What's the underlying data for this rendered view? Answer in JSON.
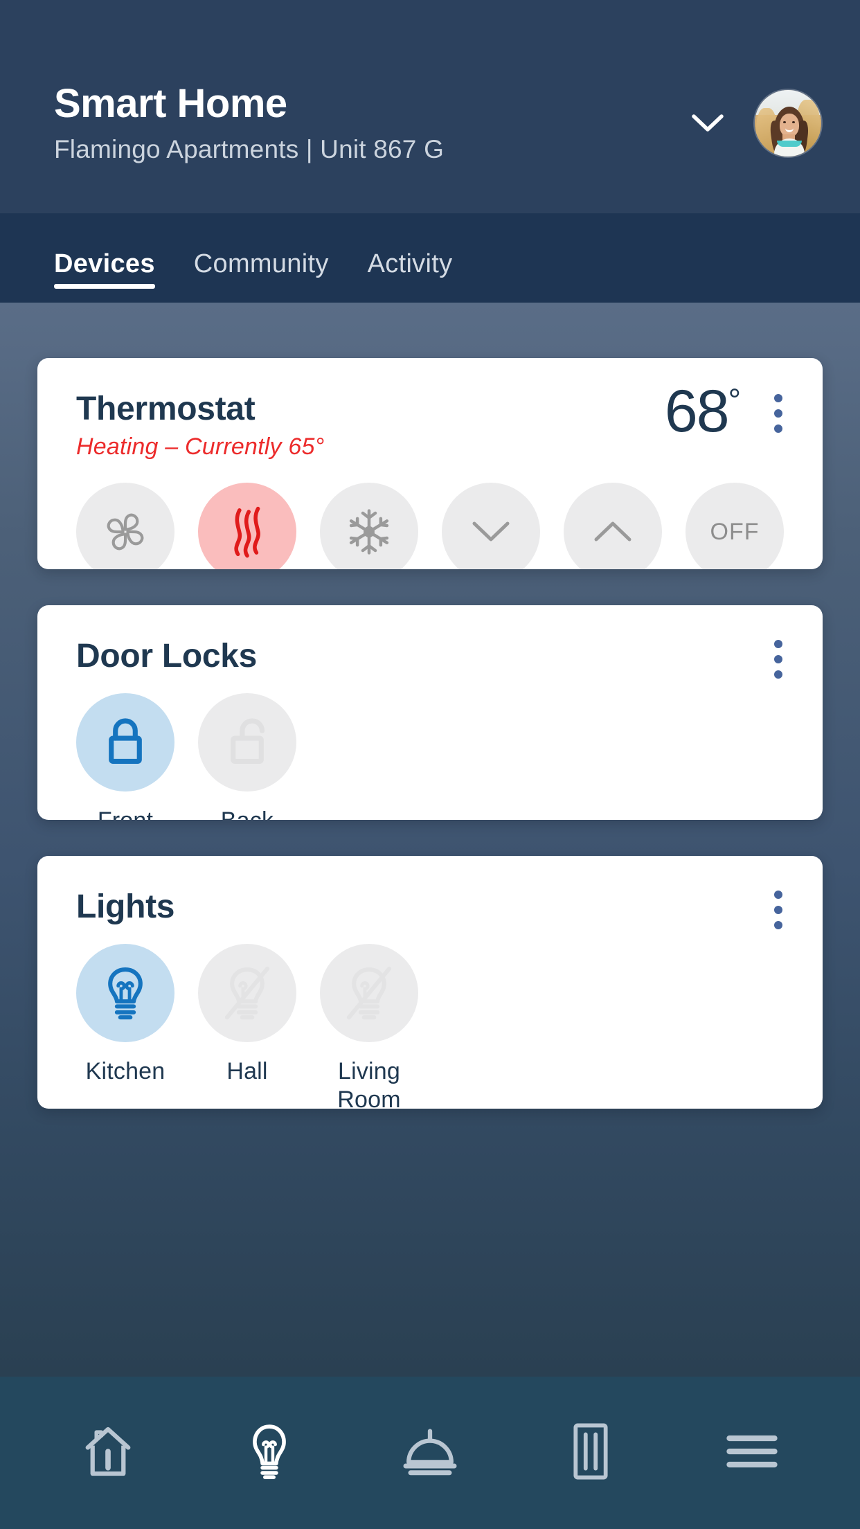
{
  "colors": {
    "header_bg": "#2c415e",
    "tabbar_bg": "#1e3553",
    "bottomnav_bg": "#24485e",
    "card_bg": "#ffffff",
    "text_dark": "#1f3850",
    "accent_blue": "#1574bf",
    "accent_blue_soft": "#c3ddf0",
    "accent_red": "#ec2b2b",
    "accent_red_soft": "#fabdbd",
    "kebab_blue": "#46649c",
    "inactive_grey": "#ebebec",
    "icon_grey": "#9a9a9a"
  },
  "header": {
    "title": "Smart Home",
    "subtitle": "Flamingo Apartments  |  Unit 867 G",
    "property": "Flamingo Apartments",
    "unit": "Unit 867 G",
    "chevron_icon": "chevron-down-icon",
    "avatar_icon": "user-avatar-photo"
  },
  "tabs": [
    {
      "label": "Devices",
      "active": true
    },
    {
      "label": "Community",
      "active": false
    },
    {
      "label": "Activity",
      "active": false
    }
  ],
  "cards": [
    {
      "id": "thermostat",
      "title": "Thermostat",
      "subtitle": "Heating – Currently 65°",
      "target_temp": "68",
      "degree_symbol": "°",
      "current_temp": "65",
      "mode": "Heating",
      "menu_icon": "kebab-menu-icon",
      "controls": [
        {
          "name": "fan",
          "icon": "fan-icon",
          "label": "",
          "state": "off"
        },
        {
          "name": "heat",
          "icon": "heat-waves-icon",
          "label": "",
          "state": "on"
        },
        {
          "name": "cool",
          "icon": "snowflake-icon",
          "label": "",
          "state": "off"
        },
        {
          "name": "temp-down",
          "icon": "chevron-down-icon",
          "label": "",
          "state": "off"
        },
        {
          "name": "temp-up",
          "icon": "chevron-up-icon",
          "label": "",
          "state": "off"
        },
        {
          "name": "power-off",
          "icon": "text-label",
          "label": "OFF",
          "state": "off"
        }
      ]
    },
    {
      "id": "locks",
      "title": "Door Locks",
      "menu_icon": "kebab-menu-icon",
      "controls": [
        {
          "name": "front-lock",
          "icon": "lock-closed-icon",
          "label": "Front",
          "state": "on"
        },
        {
          "name": "back-lock",
          "icon": "lock-open-icon",
          "label": "Back",
          "state": "off"
        }
      ]
    },
    {
      "id": "lights",
      "title": "Lights",
      "menu_icon": "kebab-menu-icon",
      "controls": [
        {
          "name": "kitchen-light",
          "icon": "lightbulb-on-icon",
          "label": "Kitchen",
          "state": "on"
        },
        {
          "name": "hall-light",
          "icon": "lightbulb-off-icon",
          "label": "Hall",
          "state": "off"
        },
        {
          "name": "living-room-light",
          "icon": "lightbulb-off-icon",
          "label": "Living Room",
          "state": "off"
        }
      ]
    }
  ],
  "bottom_nav": [
    {
      "name": "home",
      "icon": "house-icon",
      "active": false
    },
    {
      "name": "lights",
      "icon": "lightbulb-icon",
      "active": true
    },
    {
      "name": "services",
      "icon": "service-bell-icon",
      "active": false
    },
    {
      "name": "access",
      "icon": "door-icon",
      "active": false
    },
    {
      "name": "menu",
      "icon": "hamburger-menu-icon",
      "active": false
    }
  ]
}
